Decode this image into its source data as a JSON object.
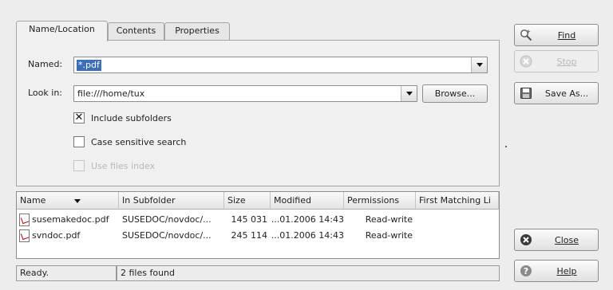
{
  "tabs": {
    "name_location": "Name/Location",
    "contents": "Contents",
    "properties": "Properties"
  },
  "form": {
    "named_label": "Named:",
    "named_value": "*.pdf",
    "lookin_label": "Look in:",
    "lookin_value": "file:///home/tux",
    "browse_label": "Browse...",
    "include_subfolders": {
      "label": "Include subfolders",
      "checked": true
    },
    "case_sensitive": {
      "label": "Case sensitive search",
      "checked": false
    },
    "use_files_index": {
      "label": "Use files index",
      "checked": false,
      "disabled": true
    }
  },
  "results": {
    "columns": [
      "Name",
      "In Subfolder",
      "Size",
      "Modified",
      "Permissions",
      "First Matching Li"
    ],
    "rows": [
      {
        "name": "susemakedoc.pdf",
        "subfolder": "SUSEDOC/novdoc/...",
        "size": "145 031",
        "modified": "...01.2006 14:43",
        "permissions": "Read-write",
        "match": ""
      },
      {
        "name": "svndoc.pdf",
        "subfolder": "SUSEDOC/novdoc/...",
        "size": "245 114",
        "modified": "...01.2006 14:43",
        "permissions": "Read-write",
        "match": ""
      }
    ]
  },
  "status": {
    "left": "Ready.",
    "right": "2 files found"
  },
  "buttons": {
    "find": "Find",
    "stop": "Stop",
    "save_as": "Save As...",
    "close": "Close",
    "help": "Help"
  },
  "icons": {
    "find": "find-magnifier-icon",
    "stop": "stop-icon",
    "save": "save-disk-icon",
    "close": "close-icon",
    "help": "help-icon",
    "file": "pdf-file-icon"
  }
}
